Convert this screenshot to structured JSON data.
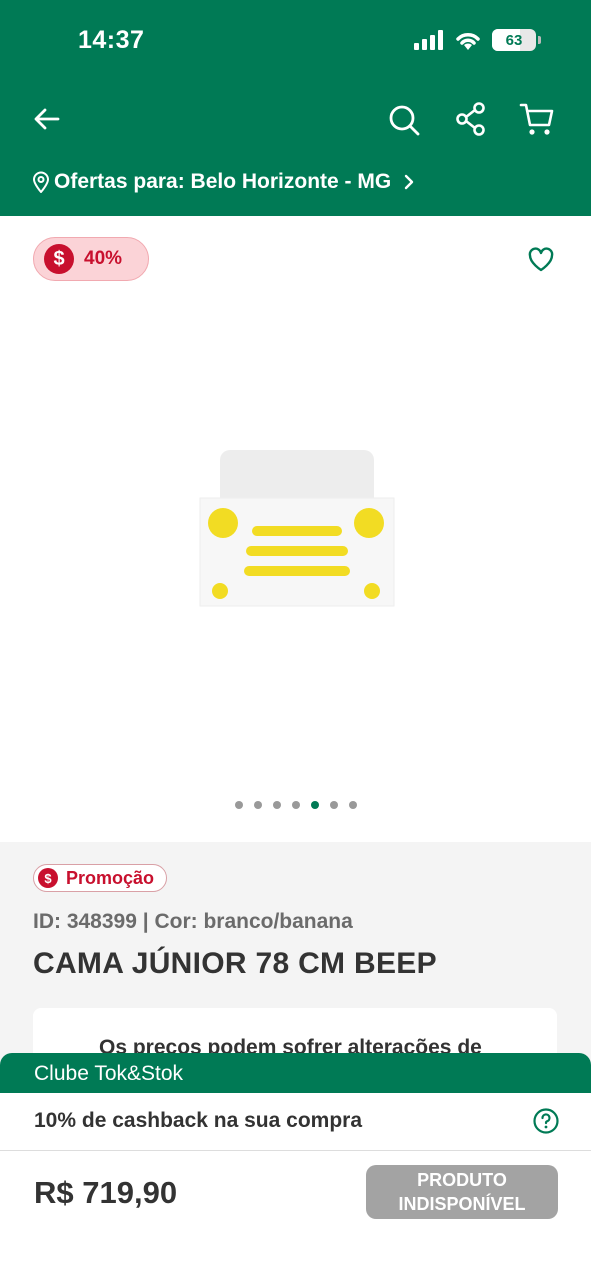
{
  "status_bar": {
    "time": "14:37",
    "battery": "63"
  },
  "header": {
    "location_label": "Ofertas para: Belo Horizonte - MG",
    "icons": [
      "back-arrow-icon",
      "search-icon",
      "share-icon",
      "cart-icon"
    ]
  },
  "gallery": {
    "discount": "40%",
    "dots_total": 7,
    "active_dot": 5
  },
  "product": {
    "promo_label": "Promoção",
    "id_line": "ID: 348399 | Cor: branco/banana",
    "title": "CAMA JÚNIOR 78 CM BEEP",
    "notice": "Os preços podem sofrer alterações de"
  },
  "club": {
    "title": "Clube Tok&Stok",
    "cashback": "10% de cashback na sua compra"
  },
  "purchase": {
    "price": "R$ 719,90",
    "button_line1": "PRODUTO",
    "button_line2": "INDISPONÍVEL"
  },
  "colors": {
    "brand_green": "#007a55",
    "promo_red": "#c8102e",
    "disabled_gray": "#a3a3a3"
  }
}
